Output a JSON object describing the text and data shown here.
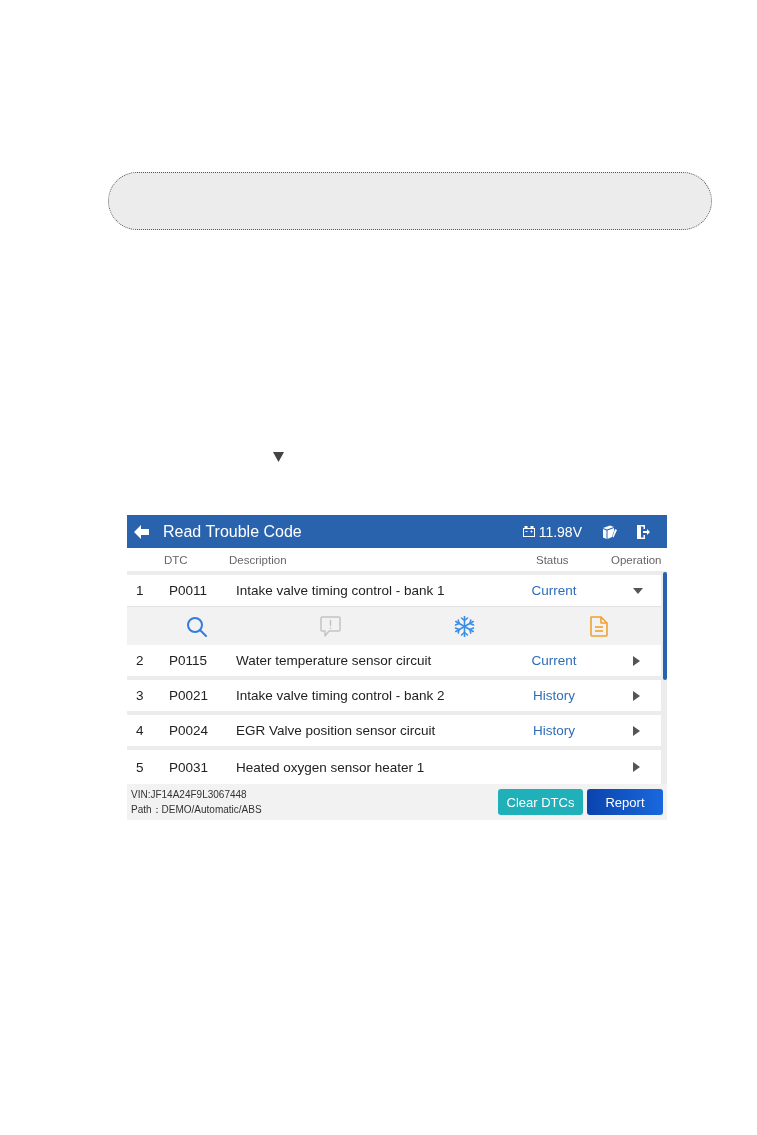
{
  "app": {
    "title": "Read Trouble Code",
    "voltage": "11.98V"
  },
  "table": {
    "columns": [
      "DTC",
      "Description",
      "Status",
      "Operation"
    ],
    "rows": [
      {
        "number": "1",
        "dtc": "P0011",
        "description": "Intake valve timing control - bank 1",
        "status": "Current",
        "expanded": true
      },
      {
        "number": "2",
        "dtc": "P0115",
        "description": "Water temperature sensor circuit",
        "status": "Current",
        "expanded": false
      },
      {
        "number": "3",
        "dtc": "P0021",
        "description": "Intake valve timing control - bank 2",
        "status": "History",
        "expanded": false
      },
      {
        "number": "4",
        "dtc": "P0024",
        "description": "EGR Valve position sensor circuit",
        "status": "History",
        "expanded": false
      },
      {
        "number": "5",
        "dtc": "P0031",
        "description": "Heated oxygen sensor heater 1",
        "expanded": false
      }
    ],
    "actions": [
      {
        "kind": "search",
        "disabled": false
      },
      {
        "kind": "message",
        "disabled": true
      },
      {
        "kind": "freeze",
        "disabled": false
      },
      {
        "kind": "report",
        "disabled": false
      }
    ]
  },
  "footer": {
    "vin": "VIN:JF14A24F9L3067448",
    "path": "Path：DEMO/Automatic/ABS",
    "buttons": [
      {
        "label": "Clear DTCs",
        "kind": "secondary"
      },
      {
        "label": "Report",
        "kind": "primary"
      }
    ]
  }
}
